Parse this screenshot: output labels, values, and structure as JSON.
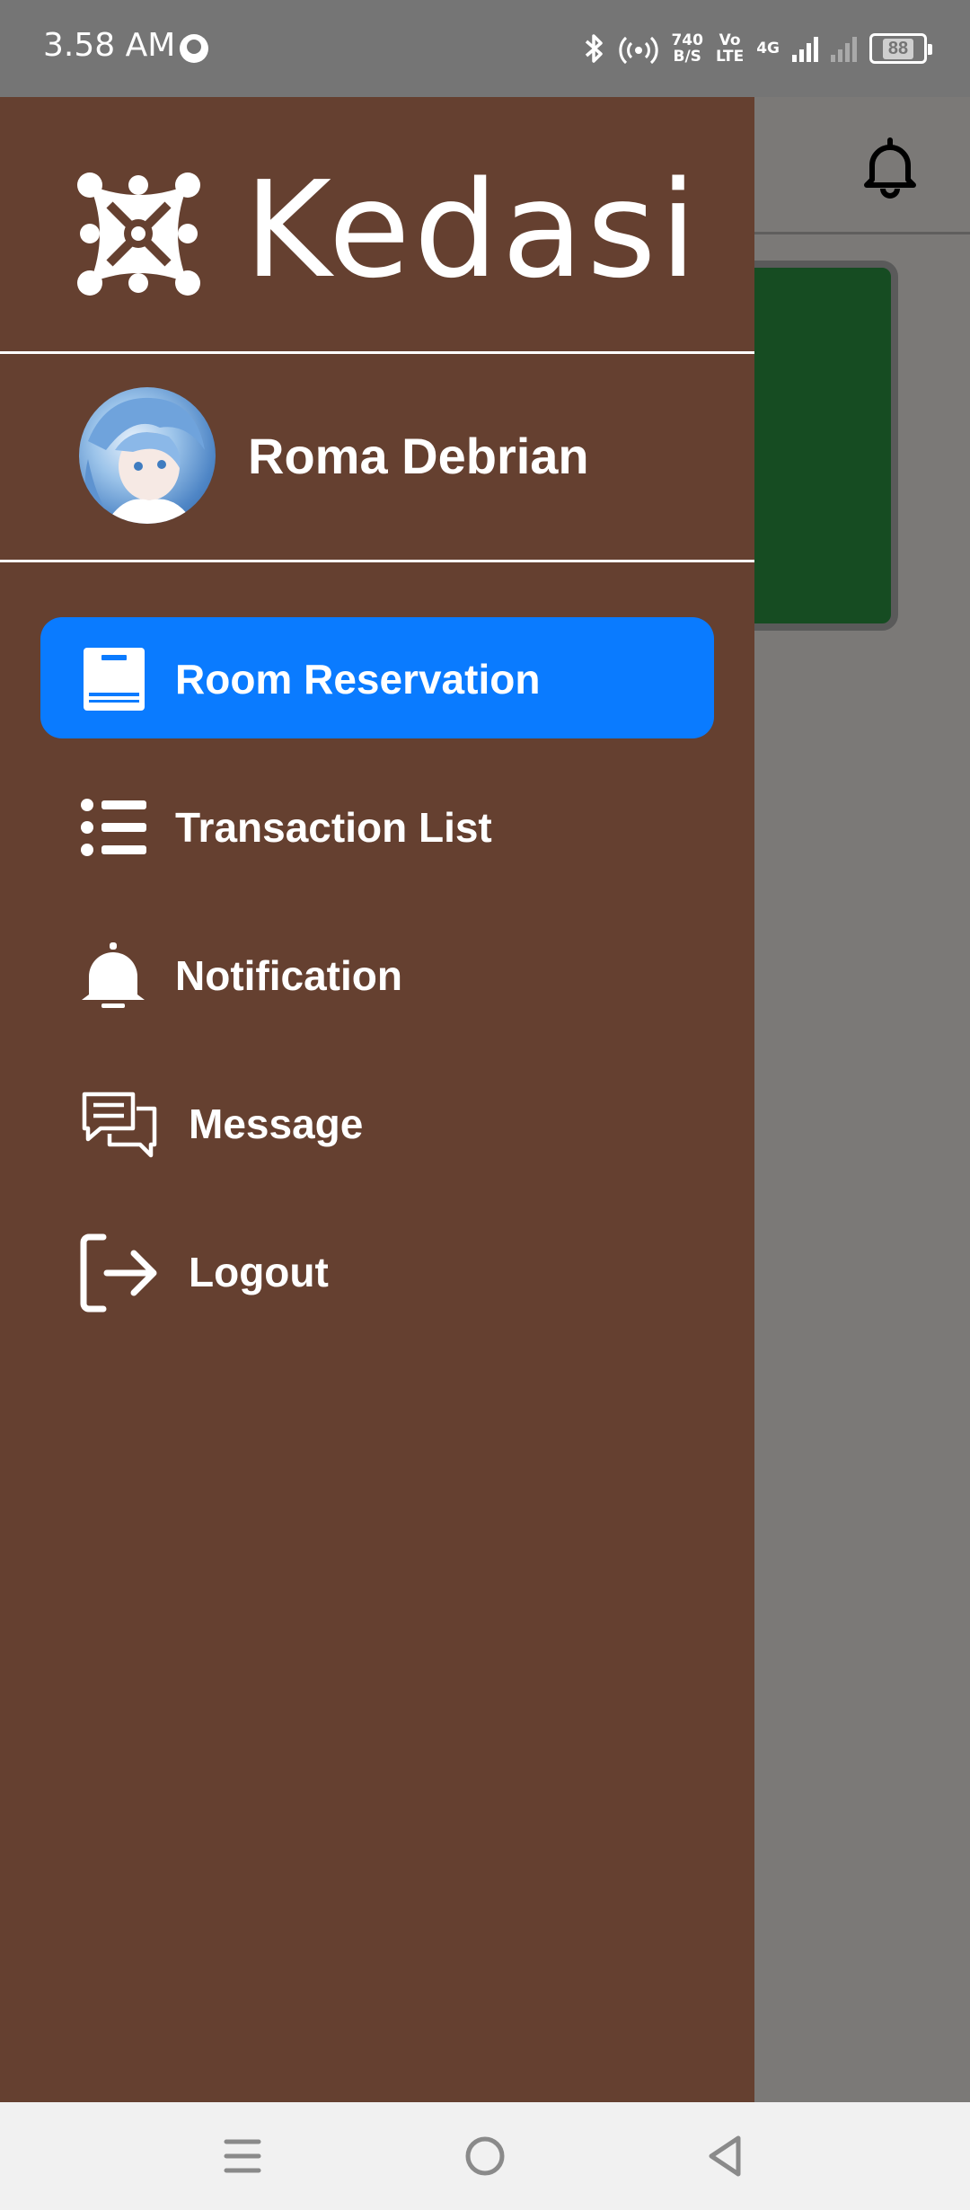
{
  "status_bar": {
    "time": "3.58 AM",
    "net_speed_value": "740",
    "net_speed_unit": "B/S",
    "volte_top": "Vo",
    "volte_bottom": "LTE",
    "network_type": "4G",
    "battery": "88",
    "icons": [
      "sync-icon",
      "bluetooth-icon",
      "hotspot-icon",
      "signal-icon",
      "battery-icon"
    ]
  },
  "background_app": {
    "bell_icon": "bell-outline-icon",
    "card_color": "#164c22"
  },
  "drawer": {
    "background": "#654030",
    "logo_text": "Kedasi",
    "user_name": "Roma Debrian",
    "menu": [
      {
        "label": "Room Reservation",
        "icon": "book-icon",
        "active": true
      },
      {
        "label": "Transaction List",
        "icon": "list-icon",
        "active": false
      },
      {
        "label": "Notification",
        "icon": "bell-icon",
        "active": false
      },
      {
        "label": "Message",
        "icon": "chat-icon",
        "active": false
      },
      {
        "label": "Logout",
        "icon": "logout-icon",
        "active": false
      }
    ],
    "active_color": "#0a7bff"
  },
  "nav_bar": {
    "icons": [
      "menu-icon",
      "home-circle-icon",
      "back-triangle-icon"
    ]
  }
}
